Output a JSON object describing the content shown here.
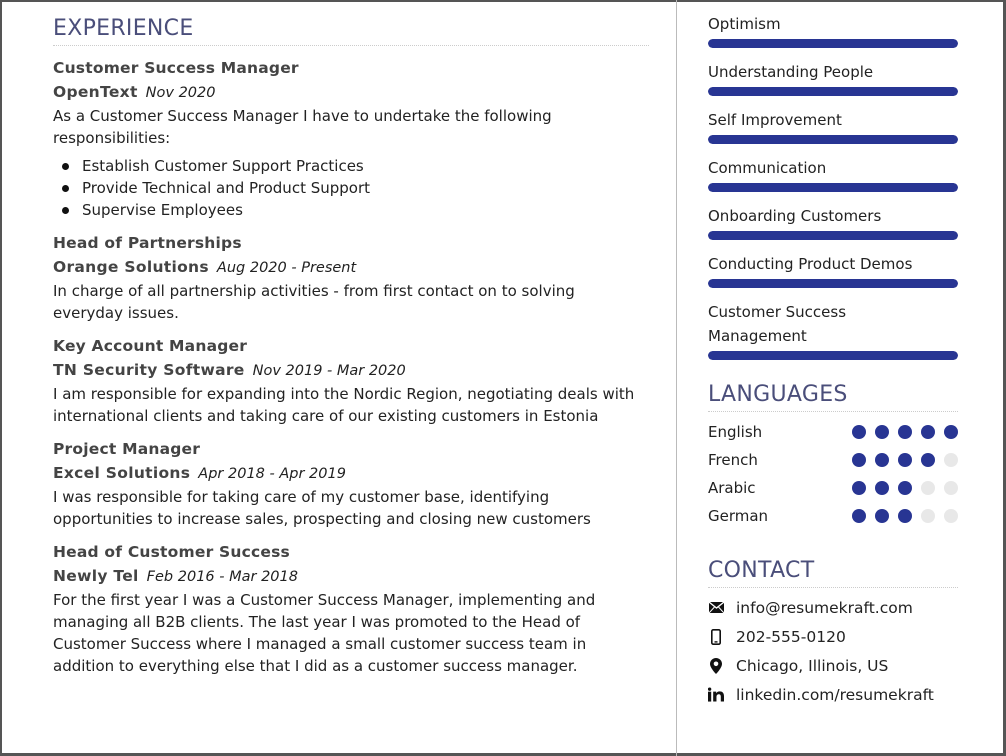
{
  "experience": {
    "title": "EXPERIENCE",
    "jobs": [
      {
        "title": "Customer Success Manager",
        "company": "OpenText",
        "dates": "Nov 2020",
        "description": "As a Customer Success Manager I have to undertake the following responsibilities:",
        "bullets": [
          "Establish Customer Support Practices",
          "Provide Technical and Product Support",
          "Supervise Employees"
        ]
      },
      {
        "title": "Head of Partnerships",
        "company": "Orange Solutions",
        "dates": "Aug 2020 - Present",
        "description": "In charge of all partnership activities - from first contact on to solving everyday issues."
      },
      {
        "title": "Key Account Manager",
        "company": "TN Security Software",
        "dates": "Nov 2019 - Mar 2020",
        "description": "I am responsible for expanding into the Nordic Region, negotiating deals with international clients and taking care of our existing customers in Estonia"
      },
      {
        "title": "Project Manager",
        "company": "Excel Solutions",
        "dates": "Apr 2018 - Apr 2019",
        "description": "I was responsible for taking care of my customer base, identifying opportunities to increase sales, prospecting and closing new customers"
      },
      {
        "title": "Head of Customer Success",
        "company": "Newly Tel",
        "dates": "Feb 2016 - Mar 2018",
        "description": "For the first year I was a Customer Success Manager, implementing and managing all B2B clients. The last year I was promoted to the Head of Customer Success where I managed a small customer success team in addition to everything else that I did as a customer success manager."
      }
    ]
  },
  "skills": [
    {
      "name": "Optimism",
      "level_percent": 100
    },
    {
      "name": "Understanding People",
      "level_percent": 100
    },
    {
      "name": "Self Improvement",
      "level_percent": 100
    },
    {
      "name": "Communication",
      "level_percent": 100
    },
    {
      "name": "Onboarding Customers",
      "level_percent": 100
    },
    {
      "name": "Conducting Product Demos",
      "level_percent": 100
    },
    {
      "name": "Customer Success Management",
      "level_percent": 100
    }
  ],
  "languages": {
    "title": "LANGUAGES",
    "max_rating": 5,
    "items": [
      {
        "name": "English",
        "rating": 5
      },
      {
        "name": "French",
        "rating": 4
      },
      {
        "name": "Arabic",
        "rating": 3
      },
      {
        "name": "German",
        "rating": 3
      }
    ]
  },
  "contact": {
    "title": "CONTACT",
    "items": [
      {
        "icon": "envelope-icon",
        "text": "info@resumekraft.com"
      },
      {
        "icon": "mobile-phone-icon",
        "text": "202-555-0120"
      },
      {
        "icon": "map-pin-icon",
        "text": "Chicago, Illinois, US"
      },
      {
        "icon": "linkedin-icon",
        "text": "linkedin.com/resumekraft"
      }
    ]
  },
  "colors": {
    "accent": "#283593",
    "heading": "#4a4e7a",
    "inactive_dot": "#e8e8e8"
  }
}
